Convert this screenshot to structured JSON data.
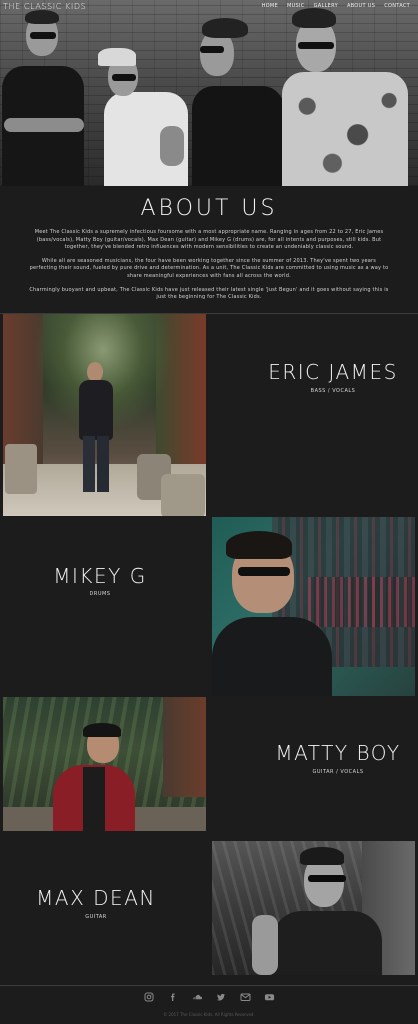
{
  "header": {
    "site_title": "The Classic Kids",
    "nav": [
      "Home",
      "Music",
      "Gallery",
      "About Us",
      "Contact"
    ]
  },
  "about": {
    "title": "About Us",
    "paragraphs": [
      "Meet The Classic Kids a supremely infectious foursome with a most appropriate name. Ranging in ages from 22 to 27, Eric James (bass/vocals), Matty Boy (guitar/vocals), Max Dean (guitar) and Mikey G (drums) are, for all intents and purposes, still kids. But together, they've blended retro influences with modern sensibilities to create an undeniably classic sound.",
      "While all are seasoned musicians, the four have been working together since the summer of 2013. They've spent two years perfecting their sound, fueled by pure drive and determination. As a unit, The Classic Kids are committed to using music as a way to share meaningful experiences with fans all across the world.",
      "Charmingly buoyant and upbeat, The Classic Kids have just released their latest single 'Just Begun' and it goes without saying this is just the beginning for The Classic Kids."
    ]
  },
  "members": [
    {
      "name": "Eric James",
      "role": "Bass / Vocals"
    },
    {
      "name": "Mikey G",
      "role": "Drums"
    },
    {
      "name": "Matty Boy",
      "role": "Guitar / Vocals"
    },
    {
      "name": "Max Dean",
      "role": "Guitar"
    }
  ],
  "footer": {
    "socials": [
      "instagram-icon",
      "facebook-icon",
      "soundcloud-icon",
      "twitter-icon",
      "email-icon",
      "youtube-icon"
    ],
    "copyright": "© 2017 The Classic Kids. All Rights Reserved."
  },
  "colors": {
    "background": "#1c1c1c",
    "text": "#f2f2f2",
    "muted": "#5a5a5a"
  }
}
